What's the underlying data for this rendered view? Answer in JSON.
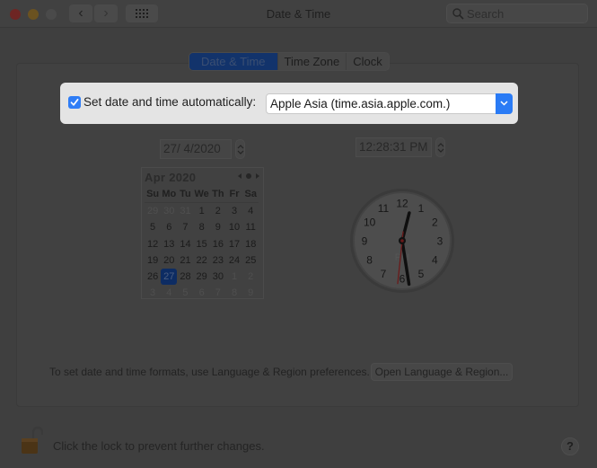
{
  "window": {
    "title": "Date & Time",
    "search_placeholder": "Search",
    "back_label": "‹",
    "forward_label": "›"
  },
  "tabs": [
    {
      "label": "Date & Time",
      "active": true
    },
    {
      "label": "Time Zone",
      "active": false
    },
    {
      "label": "Clock",
      "active": false
    }
  ],
  "auto": {
    "checked": true,
    "label": "Set date and time automatically:",
    "server": "Apple Asia (time.asia.apple.com.)"
  },
  "date_field": "27/  4/2020",
  "time_field": "12:28:31 PM",
  "calendar": {
    "month_label": "Apr 2020",
    "weekdays": [
      "Su",
      "Mo",
      "Tu",
      "We",
      "Th",
      "Fr",
      "Sa"
    ],
    "weeks": [
      [
        "29",
        "30",
        "31",
        "1",
        "2",
        "3",
        "4"
      ],
      [
        "5",
        "6",
        "7",
        "8",
        "9",
        "10",
        "11"
      ],
      [
        "12",
        "13",
        "14",
        "15",
        "16",
        "17",
        "18"
      ],
      [
        "19",
        "20",
        "21",
        "22",
        "23",
        "24",
        "25"
      ],
      [
        "26",
        "27",
        "28",
        "29",
        "30",
        "1",
        "2"
      ],
      [
        "3",
        "4",
        "5",
        "6",
        "7",
        "8",
        "9"
      ]
    ],
    "selected": "27"
  },
  "clock": {
    "numbers": [
      "12",
      "1",
      "2",
      "3",
      "4",
      "5",
      "6",
      "7",
      "8",
      "9",
      "10",
      "11"
    ],
    "ampm": "PM",
    "hour": 12,
    "minute": 28,
    "second": 31
  },
  "formats": {
    "text": "To set date and time formats, use Language & Region preferences.",
    "button_label": "Open Language & Region..."
  },
  "lock": {
    "text": "Click the lock to prevent further changes."
  },
  "help_label": "?"
}
